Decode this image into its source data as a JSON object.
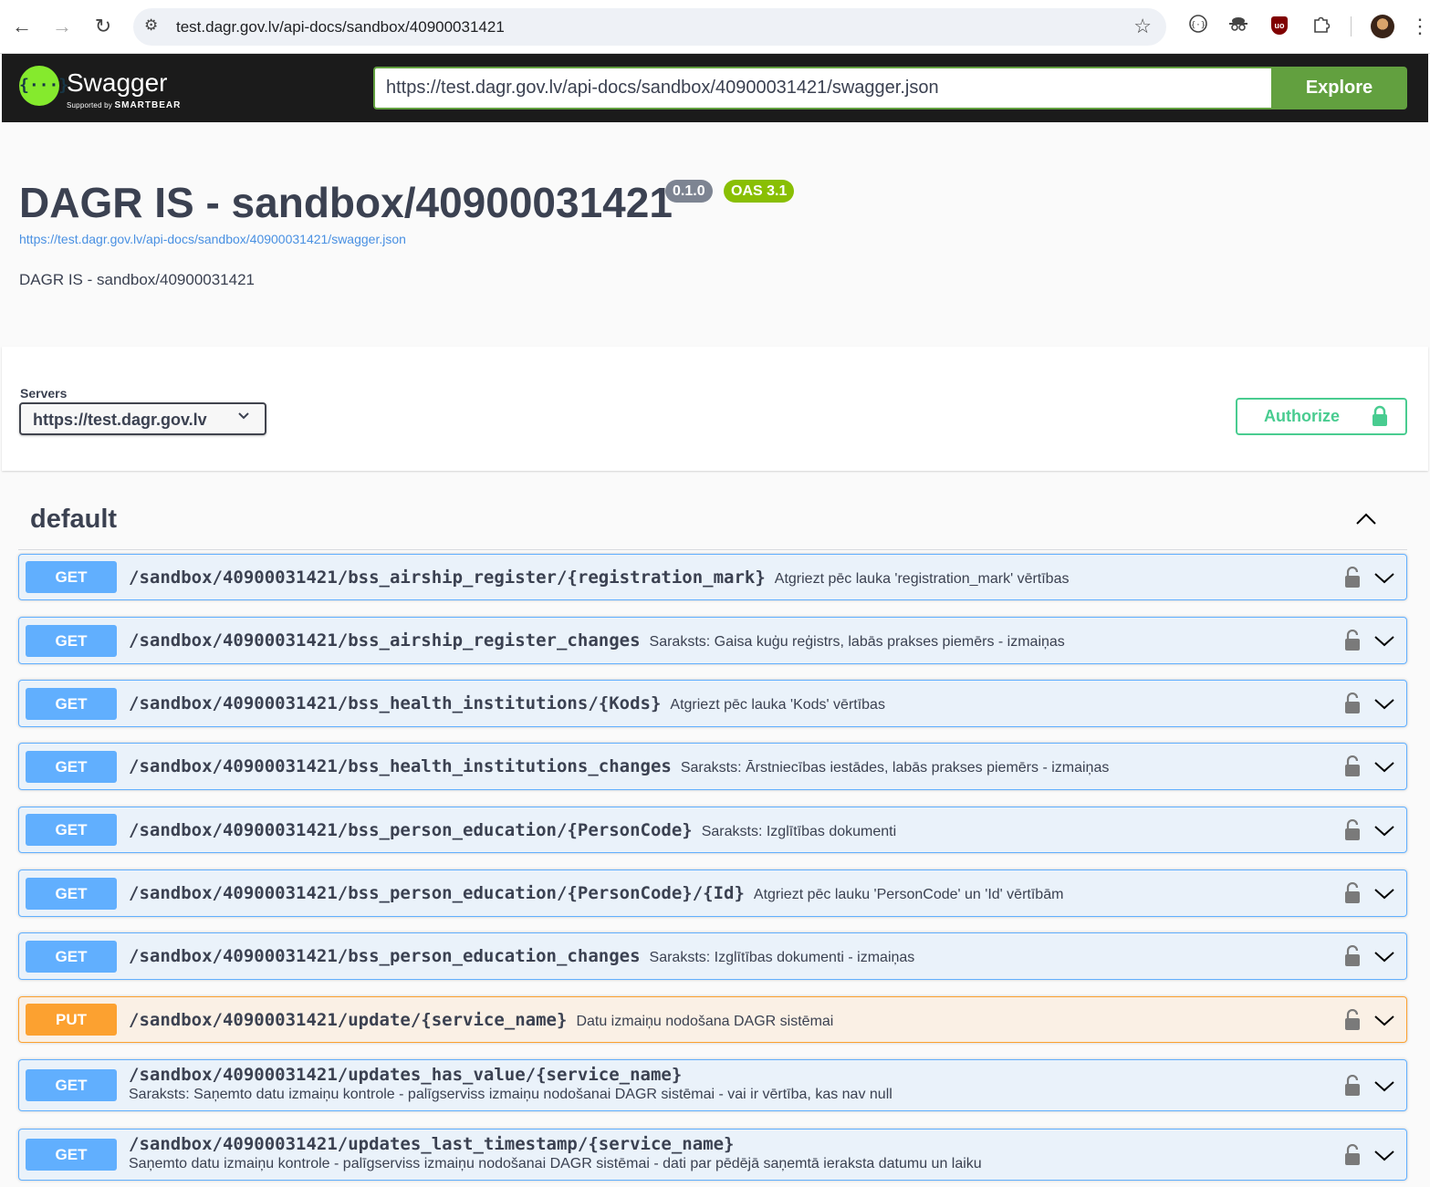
{
  "browser": {
    "url": "test.dagr.gov.lv/api-docs/sandbox/40900031421",
    "icons": [
      "back-arrow-icon",
      "forward-arrow-icon",
      "reload-icon",
      "site-info-icon",
      "bookmark-star-icon",
      "extension-icon",
      "ublock-icon",
      "puzzle-icon",
      "profile-avatar"
    ],
    "ublock_label": "uo"
  },
  "topbar": {
    "logo_symbol": "{···}",
    "logo_text": "Swagger",
    "logo_sub_prefix": "Supported by",
    "logo_sub_brand": "SMARTBEAR",
    "spec_url": "https://test.dagr.gov.lv/api-docs/sandbox/40900031421/swagger.json",
    "explore_label": "Explore"
  },
  "info": {
    "title": "DAGR IS - sandbox/40900031421",
    "version": "0.1.0",
    "oas": "OAS 3.1",
    "link": "https://test.dagr.gov.lv/api-docs/sandbox/40900031421/swagger.json",
    "description": "DAGR IS - sandbox/40900031421"
  },
  "servers": {
    "label": "Servers",
    "selected": "https://test.dagr.gov.lv"
  },
  "authorize": {
    "label": "Authorize"
  },
  "tag": {
    "name": "default"
  },
  "colors": {
    "get": "#61affe",
    "put": "#fca130",
    "authorize": "#49cc90",
    "explore": "#62a03f",
    "oas": "#89bf04"
  },
  "operations": [
    {
      "method": "GET",
      "path": "/sandbox/40900031421/bss_airship_register/{registration_mark}",
      "summary": "Atgriezt pēc lauka 'registration_mark' vērtības"
    },
    {
      "method": "GET",
      "path": "/sandbox/40900031421/bss_airship_register_changes",
      "summary": "Saraksts: Gaisa kuģu reģistrs, labās prakses piemērs - izmaiņas"
    },
    {
      "method": "GET",
      "path": "/sandbox/40900031421/bss_health_institutions/{Kods}",
      "summary": "Atgriezt pēc lauka 'Kods' vērtības"
    },
    {
      "method": "GET",
      "path": "/sandbox/40900031421/bss_health_institutions_changes",
      "summary": "Saraksts: Ārstniecības iestādes, labās prakses piemērs - izmaiņas"
    },
    {
      "method": "GET",
      "path": "/sandbox/40900031421/bss_person_education/{PersonCode}",
      "summary": "Saraksts: Izglītības dokumenti"
    },
    {
      "method": "GET",
      "path": "/sandbox/40900031421/bss_person_education/{PersonCode}/{Id}",
      "summary": "Atgriezt pēc lauku 'PersonCode' un 'Id' vērtībām"
    },
    {
      "method": "GET",
      "path": "/sandbox/40900031421/bss_person_education_changes",
      "summary": "Saraksts: Izglītības dokumenti - izmaiņas"
    },
    {
      "method": "PUT",
      "path": "/sandbox/40900031421/update/{service_name}",
      "summary": "Datu izmaiņu nodošana DAGR sistēmai"
    },
    {
      "method": "GET",
      "path": "/sandbox/40900031421/updates_has_value/{service_name}",
      "summary": "Saraksts: Saņemto datu izmaiņu kontrole - palīgserviss izmaiņu nodošanai DAGR sistēmai - vai ir vērtība, kas nav null"
    },
    {
      "method": "GET",
      "path": "/sandbox/40900031421/updates_last_timestamp/{service_name}",
      "summary": "Saņemto datu izmaiņu kontrole - palīgserviss izmaiņu nodošanai DAGR sistēmai - dati par pēdējā saņemtā ieraksta datumu un laiku"
    }
  ]
}
